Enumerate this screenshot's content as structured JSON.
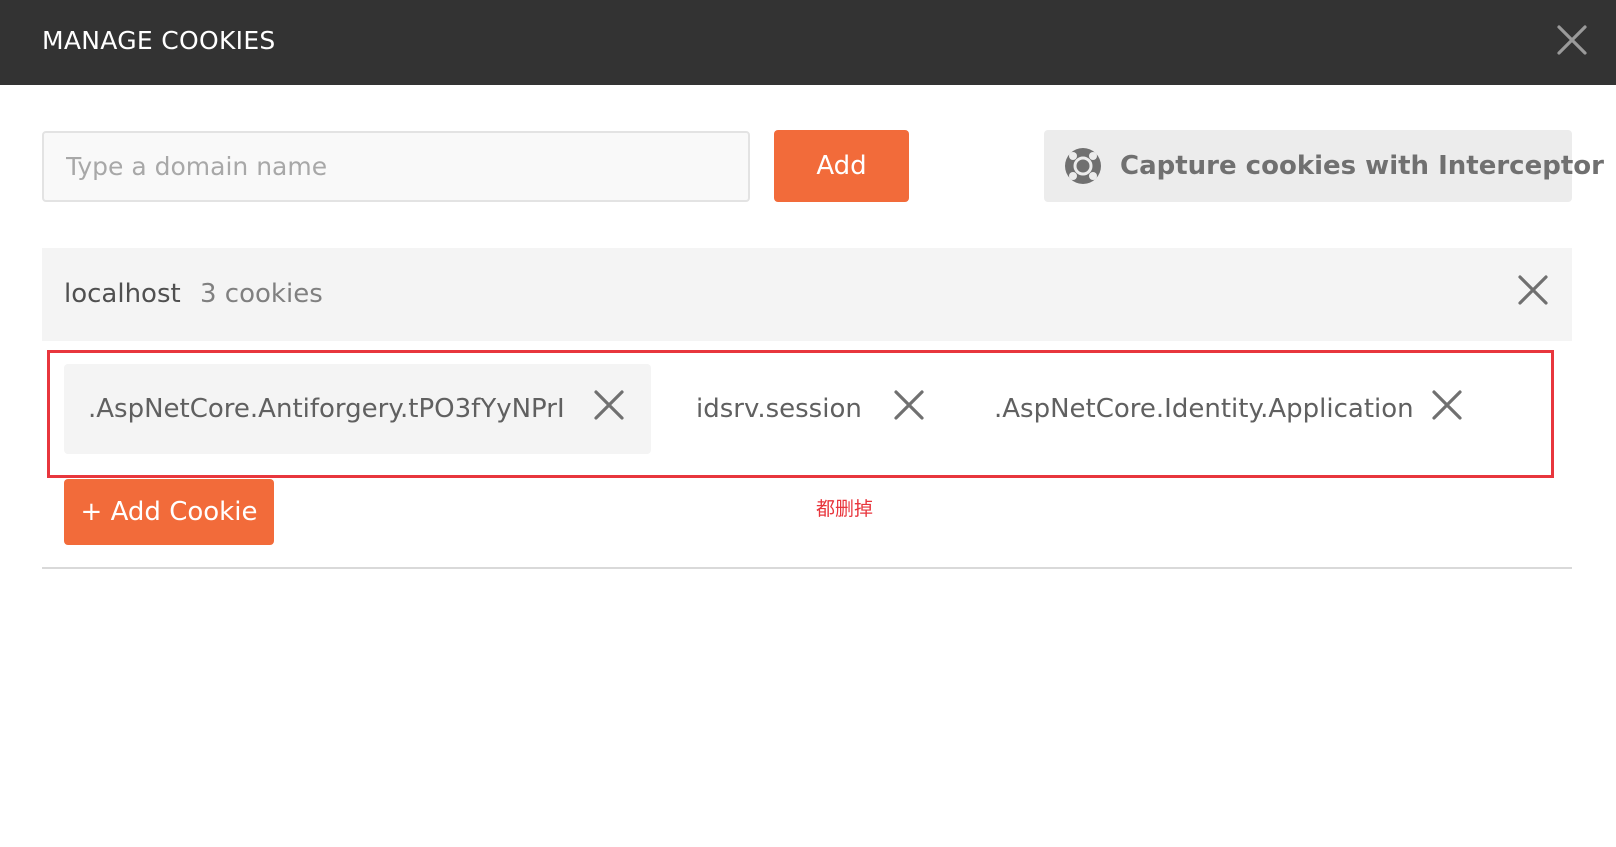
{
  "header": {
    "title": "MANAGE COOKIES",
    "close_icon": "close-icon"
  },
  "domain_form": {
    "input_value": "",
    "input_placeholder": "Type a domain name",
    "add_label": "Add",
    "capture_label": "Capture cookies with Interceptor",
    "capture_icon": "interceptor-icon"
  },
  "domains": [
    {
      "name": "localhost",
      "count_label": "3 cookies",
      "remove_icon": "close-icon",
      "cookies": [
        {
          "name": ".AspNetCore.Antiforgery.tPO3fYyNPrI",
          "active": true
        },
        {
          "name": "idsrv.session",
          "active": false
        },
        {
          "name": ".AspNetCore.Identity.Application",
          "active": false
        }
      ],
      "add_cookie_label": "+ Add Cookie"
    }
  ],
  "annotation": {
    "text": "都删掉"
  },
  "colors": {
    "header_bg": "#333333",
    "accent": "#f26b3a",
    "annotation": "#e8363d",
    "panel_bg": "#f4f4f4"
  }
}
